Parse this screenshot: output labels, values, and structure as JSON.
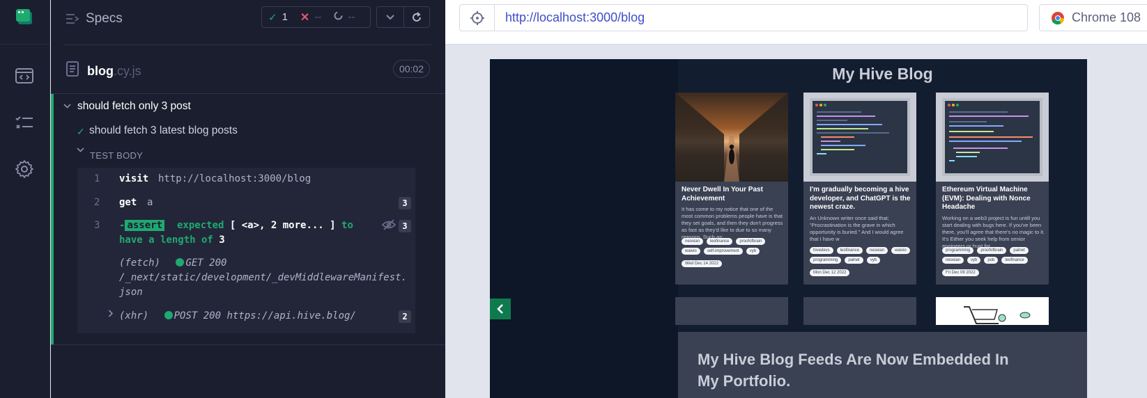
{
  "nav": {
    "icons": [
      "cypress-logo-icon",
      "specs-list-icon",
      "runs-icon",
      "settings-icon"
    ]
  },
  "reporter": {
    "specs_label": "Specs",
    "stats": {
      "passed": "1",
      "failed": "--",
      "pending": "--"
    },
    "spec_file": {
      "name": "blog",
      "ext": ".cy.js",
      "duration": "00:02"
    },
    "suite_title": "should fetch only 3 post",
    "test_title": "should fetch 3 latest blog posts",
    "test_body_label": "TEST BODY",
    "commands": [
      {
        "num": "1",
        "name": "visit",
        "message": "http://localhost:3000/blog"
      },
      {
        "num": "2",
        "name": "get",
        "message": "a",
        "badge": "3"
      },
      {
        "num": "3",
        "name": "-assert",
        "tag": "assert",
        "message_prefix": "expected",
        "message_body": "[ <a>, 2 more... ]",
        "message_to": "to",
        "message_line2": "have a length of",
        "message_value": "3",
        "badge": "3"
      }
    ],
    "fetch_log": {
      "type": "(fetch)",
      "method": "GET 200",
      "path_line1": "/_next/static/development/_devMiddlewareManifest.",
      "path_line2": "json"
    },
    "xhr_log": {
      "type": "(xhr)",
      "text": "POST 200 https://api.hive.blog/",
      "badge": "2"
    }
  },
  "browser": {
    "url": "http://localhost:3000/blog",
    "browser_name": "Chrome 108"
  },
  "blog": {
    "title": "My Hive Blog",
    "cards": [
      {
        "title": "Never Dwell In Your Past Achievement",
        "text": "It has come to my notice that one of the most common problems people have is that they set goals, and then they don't progress as fast as they'd like to due to so many reasons. Such as;",
        "tags": [
          "neoxian",
          "leofinance",
          "proofofbrain",
          "waivio",
          "self-improvement",
          "vyb"
        ],
        "date": "Wed Dec 14 2022"
      },
      {
        "title": "I'm gradually becoming a hive developer, and ChatGPT is the newest craze.",
        "text": "An Unknown writer once said that; \"Procrastination is the grave in which opportunity is buried.\" And I would agree that I have w",
        "tags": [
          "hivedevs",
          "leofinance",
          "neoxian",
          "waivio",
          "programming",
          "palnet",
          "vyb"
        ],
        "date": "Mon Dec 12 2022"
      },
      {
        "title": "Ethereum Virtual Machine (EVM): Dealing with Nonce Headache",
        "text": "Working on a web3 project is fun untill you start dealing with bugs here. If you've been there, you'll agree that there's no magic to it. It's Either you seek help from senior engineers or hunt for",
        "tags": [
          "programming",
          "proofofbrain",
          "palnet",
          "neoxian",
          "vyb",
          "pob",
          "leofinance"
        ],
        "date": "Fri Dec 09 2022"
      }
    ],
    "banner_title": "My Hive Blog Feeds Are Now Embedded In My Portfolio."
  },
  "colors": {
    "pass": "#1fa971",
    "fail": "#e45770",
    "panel": "#1b1e2e",
    "link": "#3f4ec9"
  }
}
